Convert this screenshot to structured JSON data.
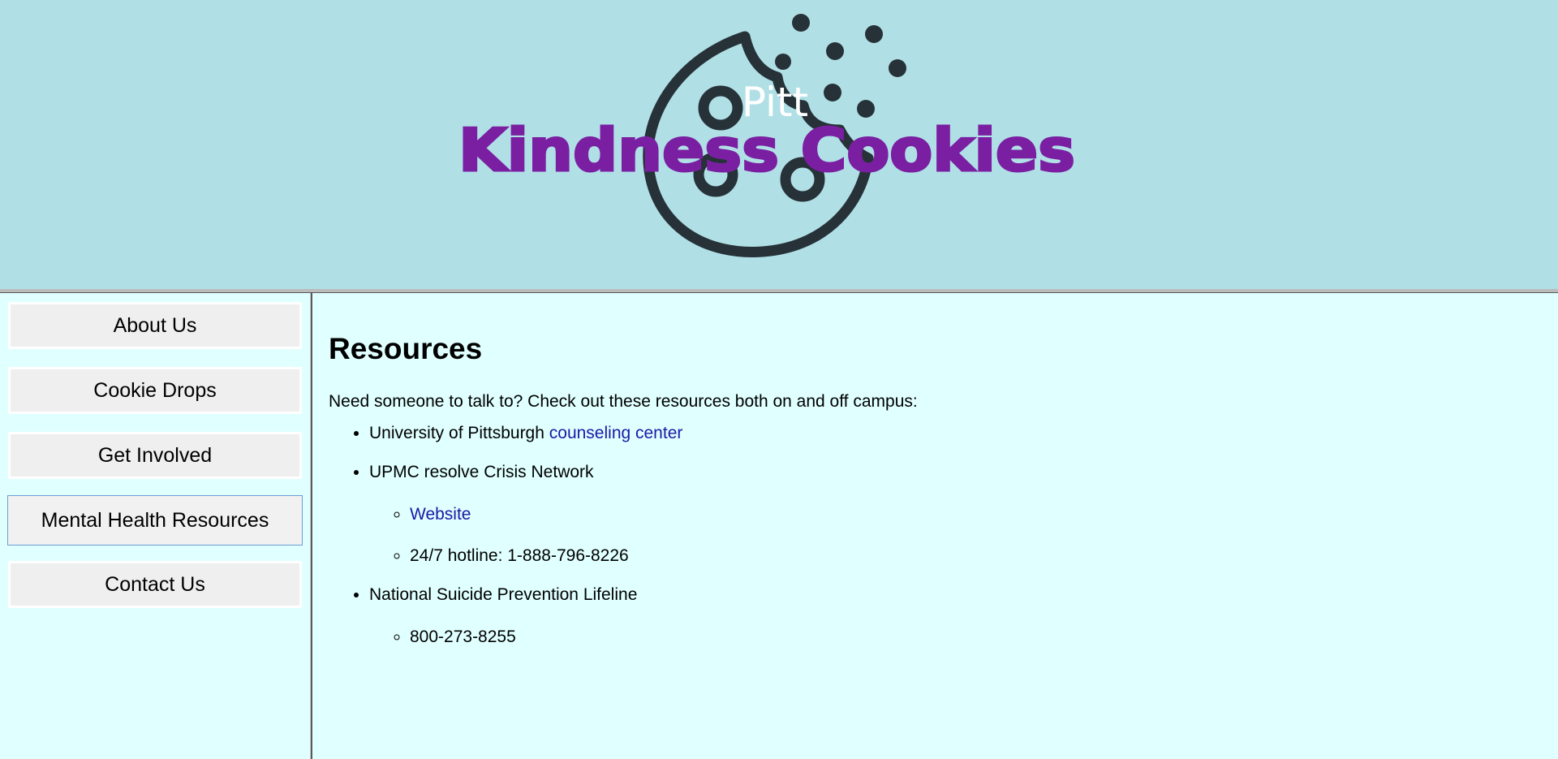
{
  "header": {
    "logo_small": "Pitt",
    "logo_main": "Kindness Cookies",
    "colors": {
      "background": "#b0e0e6",
      "logo_text": "#7b1fa2",
      "cookie": "#263238"
    }
  },
  "sidebar": {
    "items": [
      {
        "label": "About Us",
        "active": false
      },
      {
        "label": "Cookie Drops",
        "active": false
      },
      {
        "label": "Get Involved",
        "active": false
      },
      {
        "label": "Mental Health Resources",
        "active": true
      },
      {
        "label": "Contact Us",
        "active": false
      }
    ]
  },
  "main": {
    "title": "Resources",
    "intro": "Need someone to talk to? Check out these resources both on and off campus:",
    "resources": [
      {
        "text": "University of Pittsburgh ",
        "link": "counseling center"
      },
      {
        "text": "UPMC resolve Crisis Network",
        "sub": [
          {
            "link": "Website"
          },
          {
            "text": "24/7 hotline: 1-888-796-8226"
          }
        ]
      },
      {
        "text": "National Suicide Prevention Lifeline",
        "sub": [
          {
            "text": "800-273-8255"
          }
        ]
      }
    ]
  }
}
